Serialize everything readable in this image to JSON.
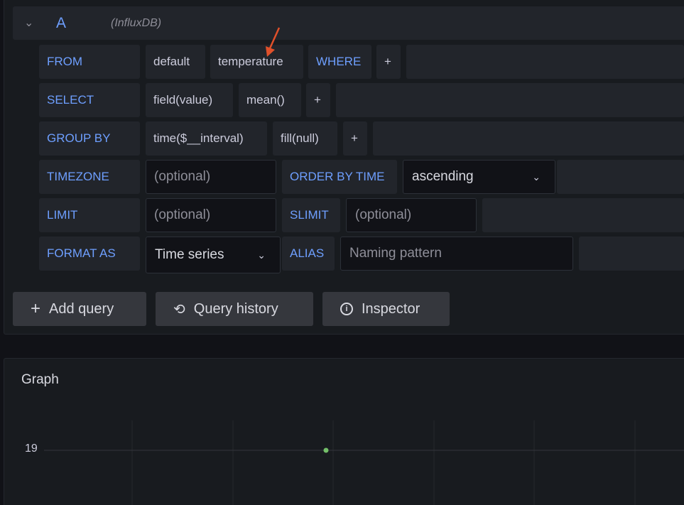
{
  "query": {
    "ref": "A",
    "datasource": "(InfluxDB)",
    "rows": {
      "from": {
        "label": "FROM",
        "policy": "default",
        "measurement": "temperature",
        "where": "WHERE",
        "add": "+"
      },
      "select": {
        "label": "SELECT",
        "field": "field(value)",
        "agg": "mean()",
        "add": "+"
      },
      "group_by": {
        "label": "GROUP BY",
        "time": "time($__interval)",
        "fill": "fill(null)",
        "add": "+"
      },
      "timezone": {
        "label": "TIMEZONE",
        "placeholder": "(optional)",
        "order_label": "ORDER BY TIME",
        "order_value": "ascending"
      },
      "limit": {
        "label": "LIMIT",
        "placeholder": "(optional)",
        "slimit_label": "SLIMIT",
        "slimit_placeholder": "(optional)"
      },
      "format": {
        "label": "FORMAT AS",
        "value": "Time series",
        "alias_label": "ALIAS",
        "alias_placeholder": "Naming pattern"
      }
    }
  },
  "buttons": {
    "add_query": "Add query",
    "query_history": "Query history",
    "inspector": "Inspector"
  },
  "graph": {
    "title": "Graph"
  },
  "colors": {
    "keyword": "#6e9fff",
    "series": "#73bf69",
    "annotation_arrow": "#e0502a"
  },
  "chart_data": {
    "type": "scatter",
    "ytick_labels": [
      "19"
    ],
    "series": [
      {
        "values": [
          19
        ]
      }
    ],
    "grid": true
  }
}
